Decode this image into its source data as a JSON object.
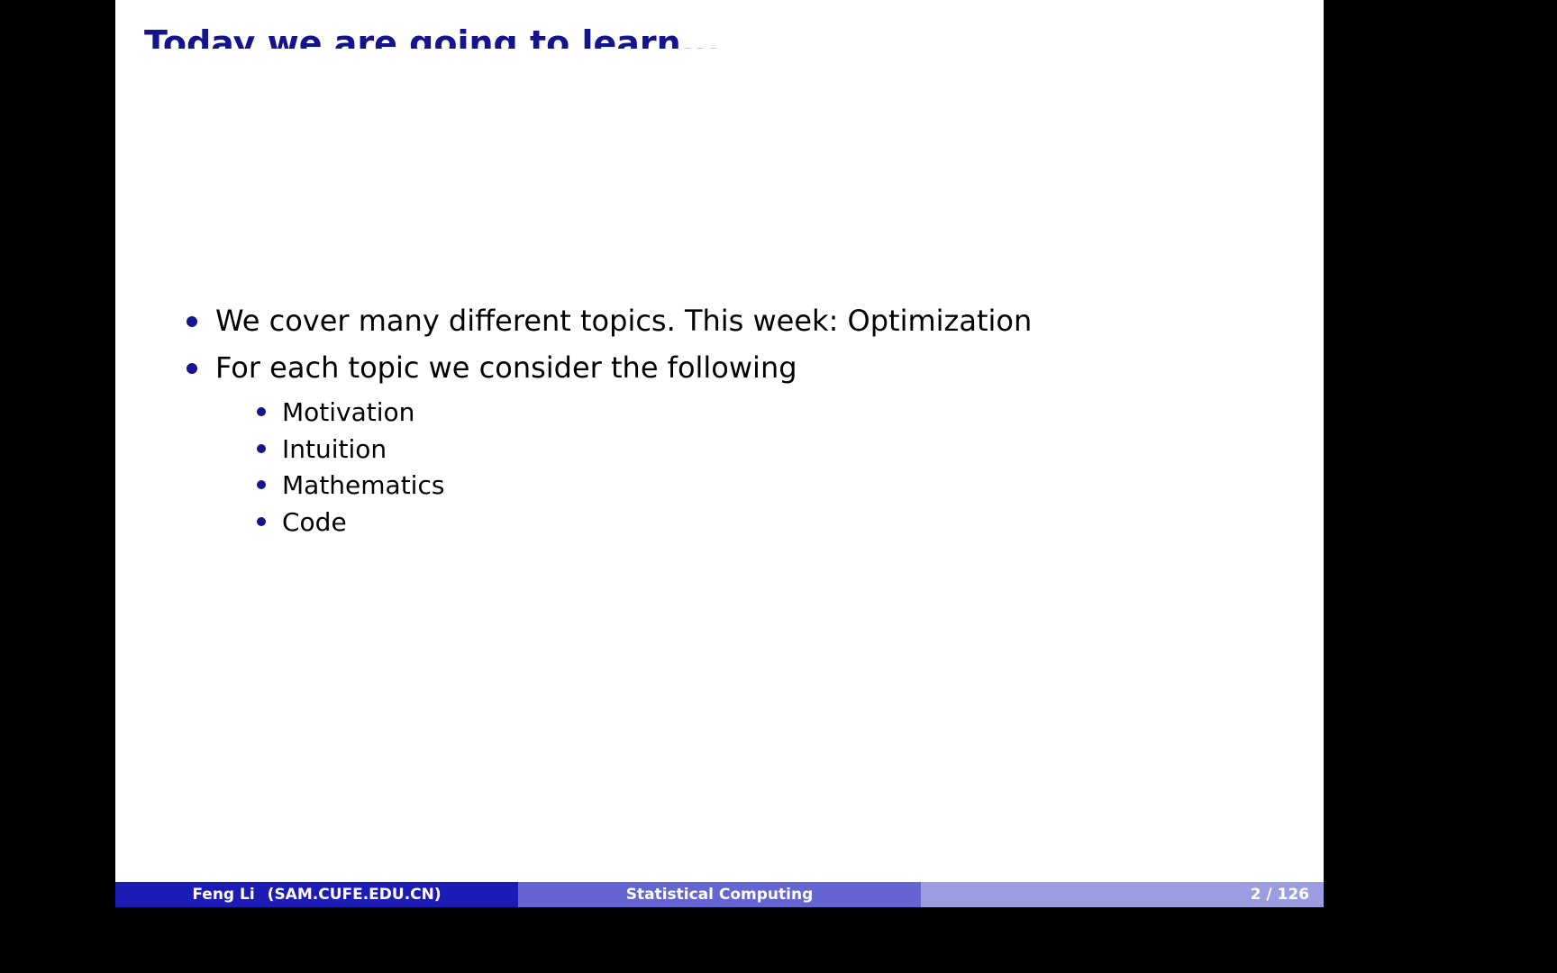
{
  "slide": {
    "title": "Today we are going to learn...",
    "bullets": [
      "We cover many different topics. This week: Optimization",
      "For each topic we consider the following"
    ],
    "sub_bullets": [
      "Motivation",
      "Intuition",
      "Mathematics",
      "Code"
    ]
  },
  "footer": {
    "author": "Feng Li",
    "institute": "(SAM.CUFE.EDU.CN)",
    "course": "Statistical Computing",
    "page": "2 / 126"
  },
  "colors": {
    "title": "#14148c",
    "footer_left": "#1c1cb4",
    "footer_mid": "#6464d2",
    "footer_right": "#9c9ce0"
  }
}
